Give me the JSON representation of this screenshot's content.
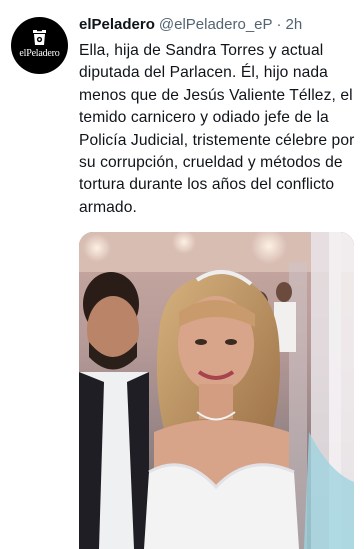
{
  "author": {
    "display_name": "elPeladero",
    "handle": "@elPeladero_eP",
    "separator": "·",
    "timestamp": "2h",
    "avatar_text": "elPeladero",
    "avatar_icon": "trash-bin-logo-icon"
  },
  "tweet": {
    "text": "Ella, hija de Sandra Torres y actual diputada del Parlacen. Él, hijo nada menos que de Jesús Valiente Téllez, el temido carnicero y odiado jefe de la Policía Judicial, tristemente célebre por su corrupción, crueldad y métodos de tortura durante los años del conflicto armado."
  },
  "media": {
    "kind": "photo",
    "subject": "wedding-photo"
  },
  "colors": {
    "text": "#0f1419",
    "secondary_text": "#536471",
    "avatar_bg": "#000000"
  }
}
